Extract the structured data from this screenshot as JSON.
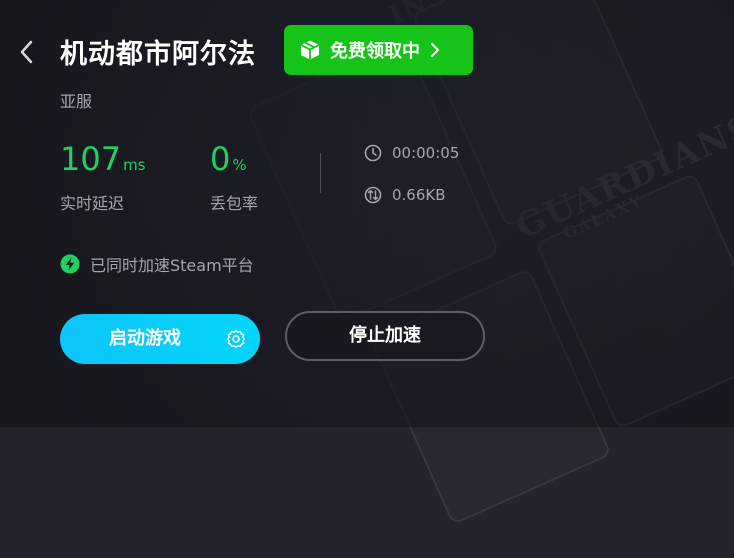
{
  "header": {
    "title": "机动都市阿尔法",
    "free_button_label": "免费领取中",
    "region": "亚服"
  },
  "stats": {
    "latency_value": "107",
    "latency_unit": "ms",
    "latency_label": "实时延迟",
    "packet_loss_value": "0",
    "packet_loss_unit": "%",
    "packet_loss_label": "丢包率",
    "duration": "00:00:05",
    "traffic": "0.66KB"
  },
  "steam_note": "已同时加速Steam平台",
  "actions": {
    "start_game_label": "启动游戏",
    "stop_accel_label": "停止加速"
  },
  "background": {
    "words": [
      "INSCRYPTION",
      "GUARDIANS",
      "GALAXY"
    ]
  },
  "colors": {
    "accent_green": "#16c318",
    "stat_green": "#1fd15f",
    "start_cyan": "#0ec4fb",
    "muted_text": "#a3a6ae"
  },
  "icons": {
    "back": "chevron-left-icon",
    "gift_box": "box-icon",
    "chevron": "chevron-right-icon",
    "clock": "clock-icon",
    "traffic": "traffic-icon",
    "bolt": "lightning-icon",
    "gear": "gear-icon"
  }
}
